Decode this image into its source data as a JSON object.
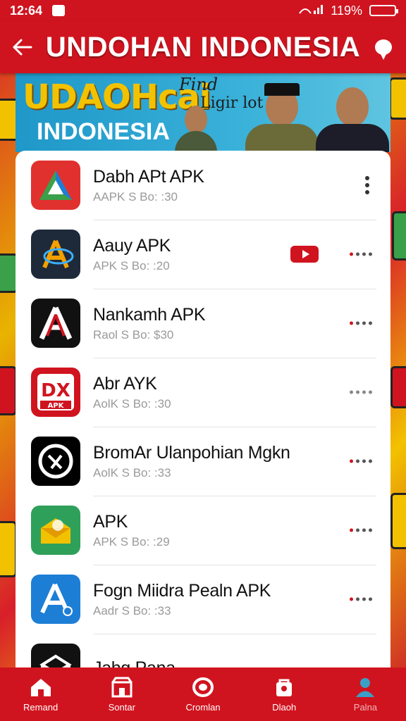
{
  "status": {
    "time": "12:64",
    "battery": "119%"
  },
  "appbar": {
    "title": "UNDOHAN INDONESIA"
  },
  "banner": {
    "brand": "UDAOHcai",
    "tagline1": "Find",
    "tagline2": "Ligir lot",
    "country": "INDONESIA"
  },
  "apps": [
    {
      "name": "Dabh APt APK",
      "meta": "AAPK S Bo: :30",
      "icon": "play-triangle-icon",
      "color": "#e0312f",
      "action": "kebab"
    },
    {
      "name": "Aauy APK",
      "meta": "APK S Bo: :20",
      "icon": "a-orbit-icon",
      "color": "#1e2a3a",
      "action": "dots-video"
    },
    {
      "name": "Nankamh APK",
      "meta": "Raol S Bo: $30",
      "icon": "red-a-icon",
      "color": "#111111",
      "action": "dots"
    },
    {
      "name": "Abr AYK",
      "meta": "AolK S Bo: :30",
      "icon": "dx-apk-icon",
      "color": "#d0141f",
      "action": "dots-light"
    },
    {
      "name": "BromAr Ulanpohian Mgkn",
      "meta": "AolK S Bo: :33",
      "icon": "circle-x-icon",
      "color": "#000000",
      "action": "dots"
    },
    {
      "name": "APK",
      "meta": "APK S Bo: :29",
      "icon": "mail-open-icon",
      "color": "#2fa05a",
      "action": "dots"
    },
    {
      "name": "Fogn Miidra Pealn APK",
      "meta": "Aadr S Bo: :33",
      "icon": "store-a-icon",
      "color": "#1d7ed6",
      "action": "dots"
    },
    {
      "name": "Jahg Pana",
      "meta": "",
      "icon": "box-icon",
      "color": "#111111",
      "action": "none"
    }
  ],
  "tabs": [
    {
      "label": "Remand",
      "icon": "home-icon"
    },
    {
      "label": "Sontar",
      "icon": "store-icon"
    },
    {
      "label": "Cromlan",
      "icon": "ring-icon"
    },
    {
      "label": "Dlaoh",
      "icon": "bag-icon"
    },
    {
      "label": "Palna",
      "icon": "profile-icon"
    }
  ]
}
